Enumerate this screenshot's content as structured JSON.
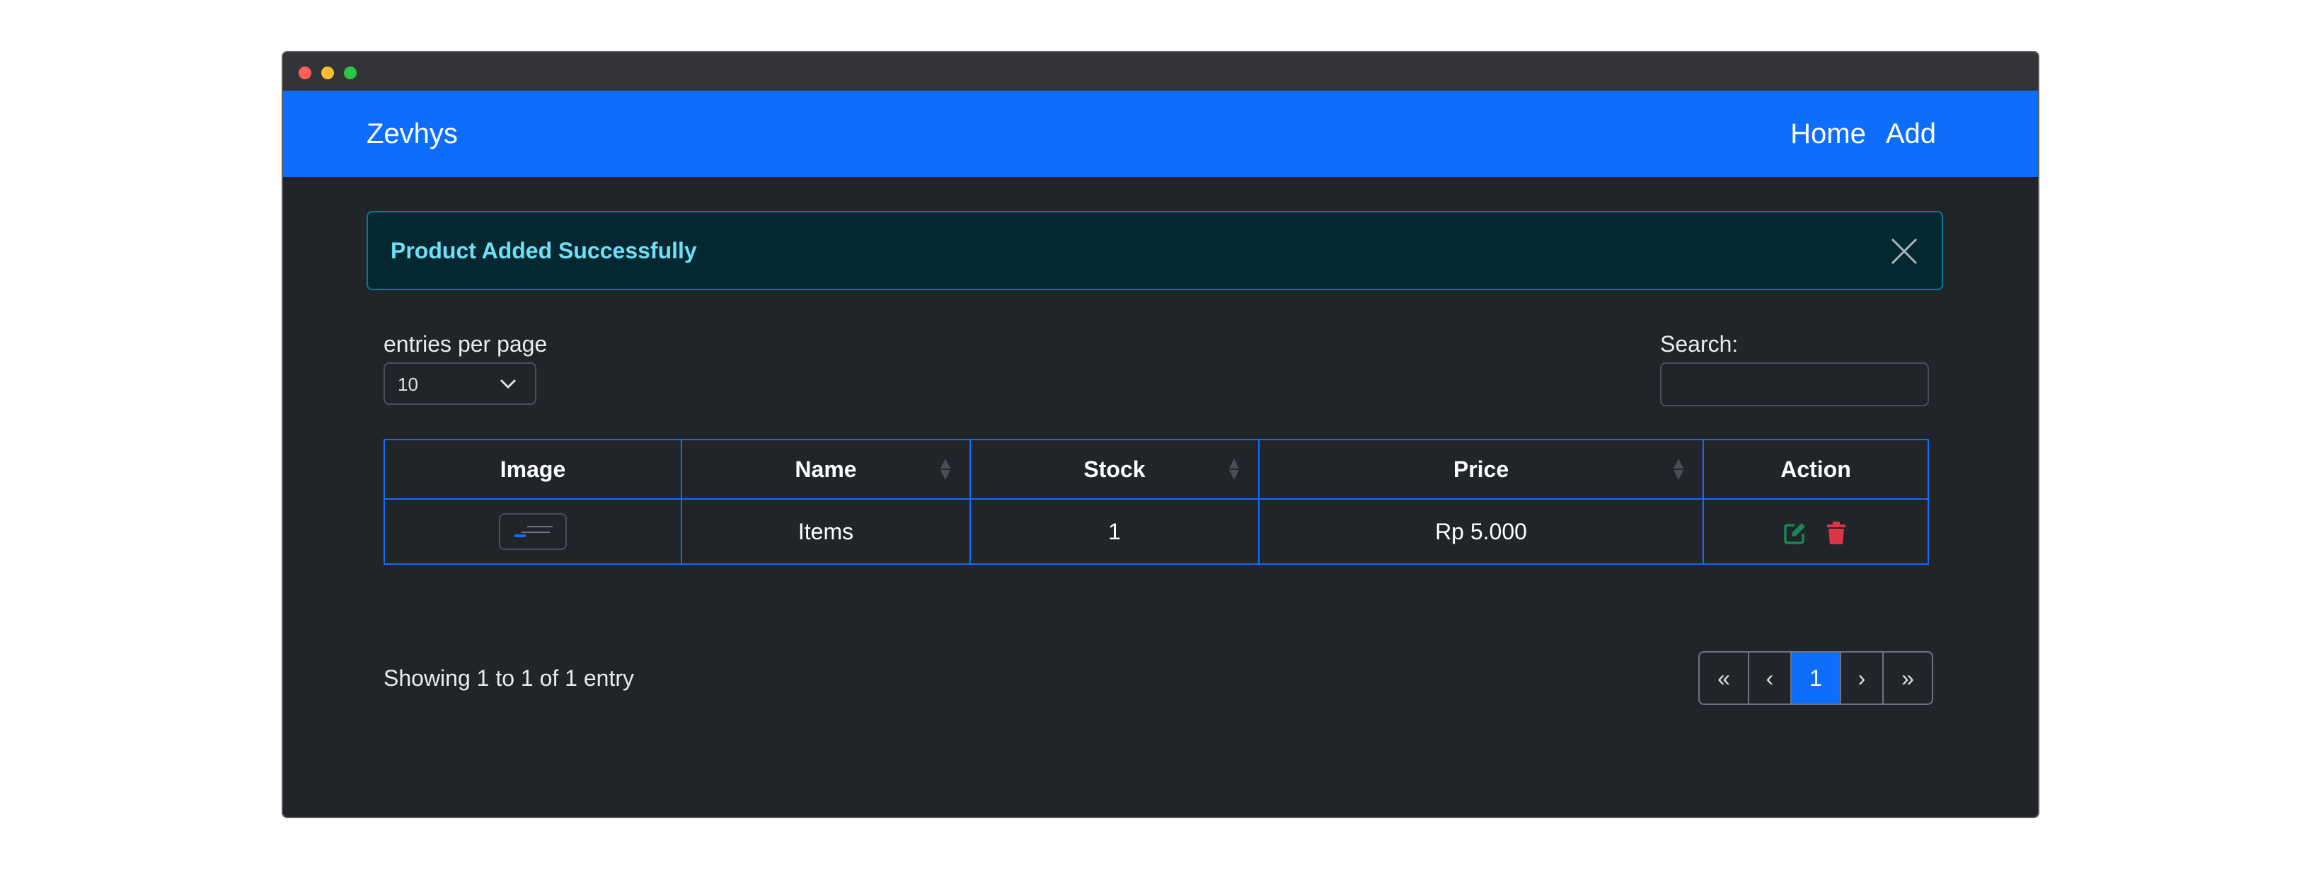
{
  "navbar": {
    "brand": "Zevhys",
    "links": [
      "Home",
      "Add"
    ],
    "bg_color": "#0d6efd"
  },
  "alert": {
    "message": "Product Added Successfully",
    "close_icon": "close-icon",
    "type": "info"
  },
  "entries": {
    "label": "entries per page",
    "selected": "10"
  },
  "search": {
    "label": "Search:",
    "value": ""
  },
  "table": {
    "columns": [
      "Image",
      "Name",
      "Stock",
      "Price",
      "Action"
    ],
    "sortable": [
      false,
      true,
      true,
      true,
      false
    ],
    "rows": [
      {
        "name": "Items",
        "stock": "1",
        "price": "Rp 5.000",
        "actions": [
          "edit-icon",
          "trash-icon"
        ]
      }
    ]
  },
  "footer": {
    "info": "Showing 1 to 1 of 1 entry"
  },
  "pagination": {
    "first": "«",
    "prev": "‹",
    "current": "1",
    "next": "›",
    "last": "»"
  },
  "colors": {
    "primary": "#0d6efd",
    "background": "#212529",
    "alert_text": "#6edff6",
    "edit": "#198754",
    "delete": "#dc3545"
  }
}
